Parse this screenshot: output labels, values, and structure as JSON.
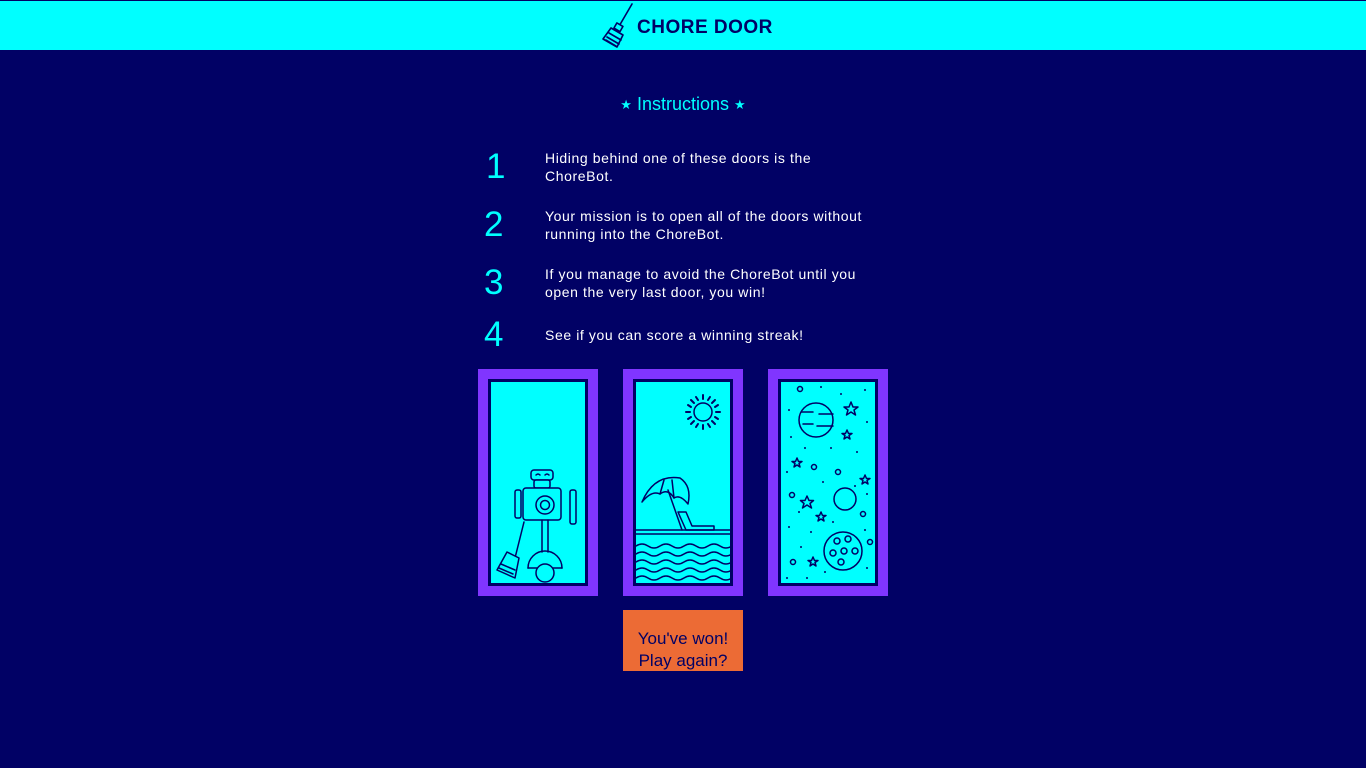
{
  "header": {
    "title": "CHORE DOOR",
    "logo_icon": "broom-icon"
  },
  "instructions": {
    "title": "Instructions",
    "star_icon": "star-icon",
    "steps": [
      {
        "number": "1",
        "text": "Hiding behind one of these doors is the ChoreBot."
      },
      {
        "number": "2",
        "text": "Your mission is to open all of the doors without running into the ChoreBot."
      },
      {
        "number": "3",
        "text": "If you manage to avoid the ChoreBot until you open the very last door, you win!"
      },
      {
        "number": "4",
        "text": "See if you can score a winning streak!"
      }
    ]
  },
  "doors": [
    {
      "content": "robot-chorebot"
    },
    {
      "content": "beach"
    },
    {
      "content": "space"
    }
  ],
  "status_button": {
    "line1": "You've won!",
    "line2": "Play again?"
  },
  "colors": {
    "background": "#010165",
    "header": "#00ffff",
    "accent": "#00ffff",
    "door_frame": "#8035ff",
    "button": "#ec6b35"
  }
}
